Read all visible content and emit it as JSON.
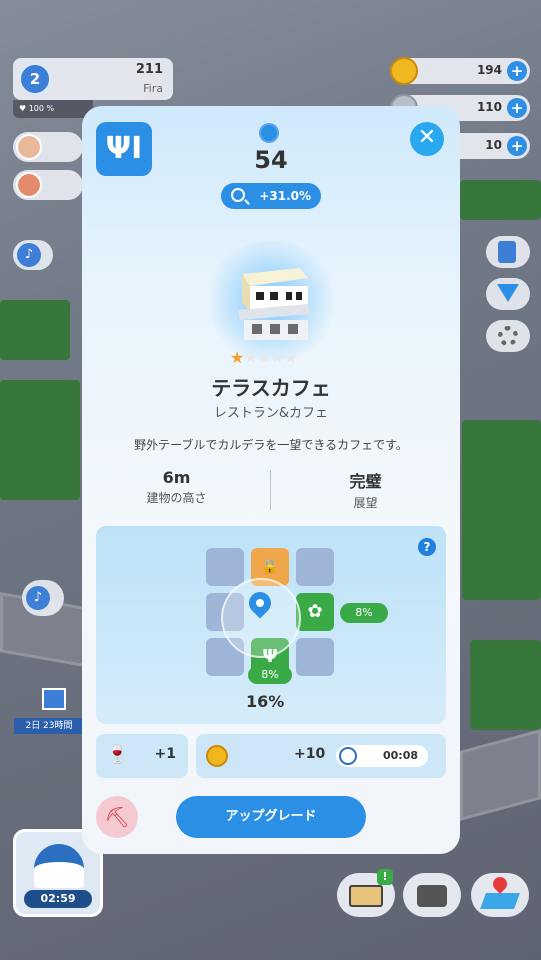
{
  "hud": {
    "level": "2",
    "population": "211",
    "city": "Fira",
    "happiness": "100 %",
    "coins": "194",
    "gems": "110",
    "tickets": "10",
    "plus_symbol": "+"
  },
  "event": {
    "timer": "2日 23時間"
  },
  "map_building": {
    "timer": "02:59"
  },
  "modal": {
    "category_icon": "fork-knife-icon",
    "close_symbol": "✕",
    "score": "54",
    "boost": "+31.0%",
    "building_name": "テラスカフェ",
    "category": "レストラン&カフェ",
    "description": "野外テーブルでカルデラを一望できるカフェです。",
    "rating": 1,
    "rating_max": 5,
    "attributes": [
      {
        "value": "6m",
        "label": "建物の高さ"
      },
      {
        "value": "完璧",
        "label": "展望"
      }
    ],
    "adjacency": {
      "help": "?",
      "right_bonus": "8%",
      "bottom_bonus": "8%",
      "total": "16%"
    },
    "rewards": {
      "item_bonus": "+1",
      "coins": "+10",
      "time": "00:08"
    },
    "upgrade_label": "アップグレード"
  },
  "colors": {
    "accent": "#2b8fe6",
    "green": "#3aaa47",
    "lock": "#f0a64a",
    "star": "#f0a02b"
  }
}
